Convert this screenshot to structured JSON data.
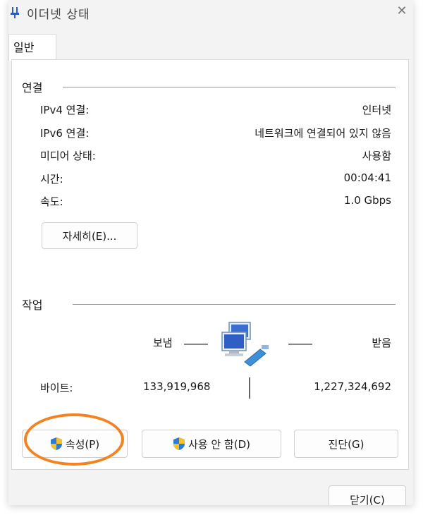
{
  "window": {
    "title": "이더넷 상태",
    "close_glyph": "✕"
  },
  "tab": {
    "label": "일반"
  },
  "connection": {
    "heading": "연결",
    "rows": [
      {
        "label": "IPv4 연결:",
        "value": "인터넷"
      },
      {
        "label": "IPv6 연결:",
        "value": "네트워크에 연결되어 있지 않음"
      },
      {
        "label": "미디어 상태:",
        "value": "사용함"
      },
      {
        "label": "시간:",
        "value": "00:04:41"
      },
      {
        "label": "속도:",
        "value": "1.0 Gbps"
      }
    ],
    "details_button": "자세히(E)..."
  },
  "activity": {
    "heading": "작업",
    "sent_label": "보냄",
    "received_label": "받음",
    "bytes_label": "바이트:",
    "bytes_sent": "133,919,968",
    "bytes_received": "1,227,324,692"
  },
  "buttons": {
    "properties": "속성(P)",
    "disable": "사용 안 함(D)",
    "diagnose": "진단(G)",
    "close": "닫기(C)"
  },
  "annotation": {
    "highlight_color": "#f58220",
    "highlight_target": "properties-button"
  }
}
